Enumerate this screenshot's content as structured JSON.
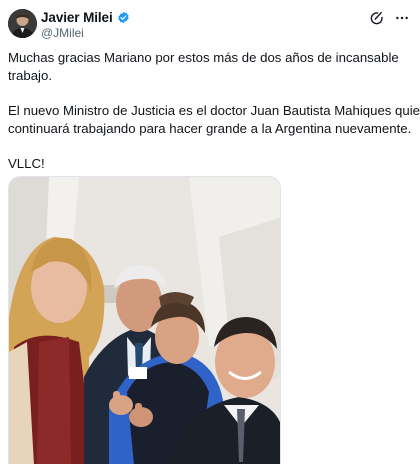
{
  "author": {
    "name": "Javier Milei",
    "handle": "@JMilei",
    "verified": true,
    "avatar_icon": "avatar-portrait",
    "verified_icon": "verified-badge-icon"
  },
  "actions": {
    "grok_icon": "grok-icon",
    "more_icon": "more-options-icon"
  },
  "tweet": {
    "paragraph1_line1": "Muchas gracias Mariano por estos más de dos años de incansable",
    "paragraph1_line2": "trabajo.",
    "paragraph2_line1": "El nuevo Ministro de Justicia es el doctor Juan Bautista Mahiques quien",
    "paragraph2_line2": "continuará trabajando para hacer grande a la Argentina nuevamente.",
    "paragraph3": "VLLC!"
  },
  "media": {
    "type": "photo",
    "description_icon": "group-selfie-photo"
  },
  "colors": {
    "text": "#0f1419",
    "secondary": "#536471",
    "verified": "#1d9bf0"
  }
}
